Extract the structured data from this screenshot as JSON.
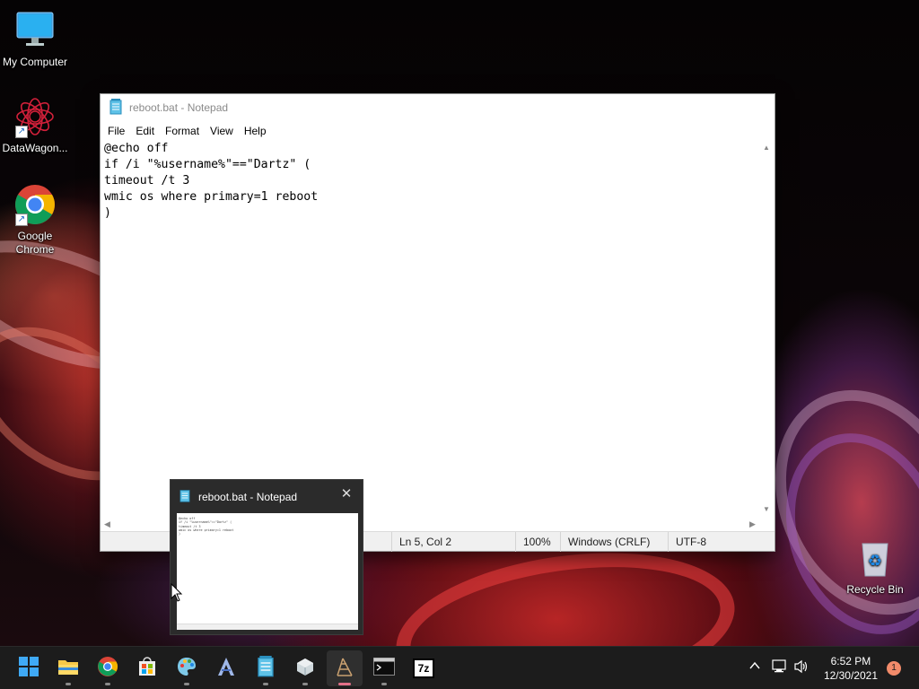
{
  "desktop": {
    "icons": [
      {
        "label": "My Computer",
        "icon": "monitor-icon"
      },
      {
        "label": "DataWagon...",
        "icon": "mandala-logo-icon"
      },
      {
        "label": "Google\nChrome",
        "icon": "chrome-icon"
      },
      {
        "label": "Recycle Bin",
        "icon": "recycle-bin-icon"
      }
    ]
  },
  "notepad": {
    "title": "reboot.bat - Notepad",
    "menu": [
      "File",
      "Edit",
      "Format",
      "View",
      "Help"
    ],
    "content": "@echo off\nif /i \"%username%\"==\"Dartz\" (\ntimeout /t 3\nwmic os where primary=1 reboot\n)",
    "status": {
      "position": "Ln 5, Col 2",
      "zoom": "100%",
      "line_ending": "Windows (CRLF)",
      "encoding": "UTF-8"
    }
  },
  "thumbnail": {
    "title": "reboot.bat - Notepad",
    "close": "✕"
  },
  "taskbar": {
    "apps": [
      {
        "name": "start-button",
        "icon": "windows-logo-icon",
        "active": false
      },
      {
        "name": "file-explorer",
        "icon": "folder-icon",
        "active": false
      },
      {
        "name": "chrome",
        "icon": "chrome-icon",
        "active": false
      },
      {
        "name": "microsoft-store",
        "icon": "store-icon",
        "active": false
      },
      {
        "name": "paint",
        "icon": "palette-icon",
        "active": false
      },
      {
        "name": "app-a",
        "icon": "letter-a-icon",
        "active": false
      },
      {
        "name": "notepad",
        "icon": "notepad-icon",
        "active": false
      },
      {
        "name": "app-box",
        "icon": "box-icon",
        "active": false
      },
      {
        "name": "app-active",
        "icon": "network-tool-icon",
        "active": true
      },
      {
        "name": "terminal",
        "icon": "terminal-icon",
        "active": false
      },
      {
        "name": "7zip",
        "icon": "7z-icon",
        "active": false
      }
    ],
    "time": "6:52 PM",
    "date": "12/30/2021",
    "notification_count": "1",
    "seven_zip_label": "7z"
  },
  "colors": {
    "taskbar_bg": "#1c1c1c",
    "active_indicator": "#e27088",
    "notification_badge": "#f28b6a"
  }
}
